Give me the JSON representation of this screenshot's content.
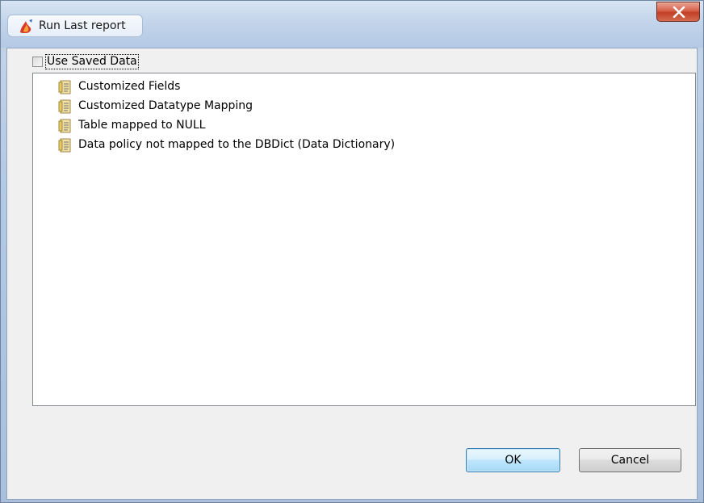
{
  "window": {
    "title": "Run Last report",
    "close_glyph": "X",
    "icon": "app-flame-icon"
  },
  "options": {
    "use_saved_data_label": "Use Saved Data",
    "use_saved_data_checked": false
  },
  "tree": {
    "items": [
      {
        "label": "Customized Fields",
        "icon": "report-document-icon"
      },
      {
        "label": "Customized Datatype Mapping",
        "icon": "report-document-icon"
      },
      {
        "label": "Table mapped to NULL",
        "icon": "report-document-icon"
      },
      {
        "label": "Data policy not mapped to the DBDict (Data Dictionary)",
        "icon": "report-document-icon"
      }
    ]
  },
  "buttons": {
    "ok_label": "OK",
    "cancel_label": "Cancel"
  },
  "colors": {
    "titlebar": "#c1d3ea",
    "close_button": "#c13f26",
    "ok_border": "#3c7fb1"
  }
}
